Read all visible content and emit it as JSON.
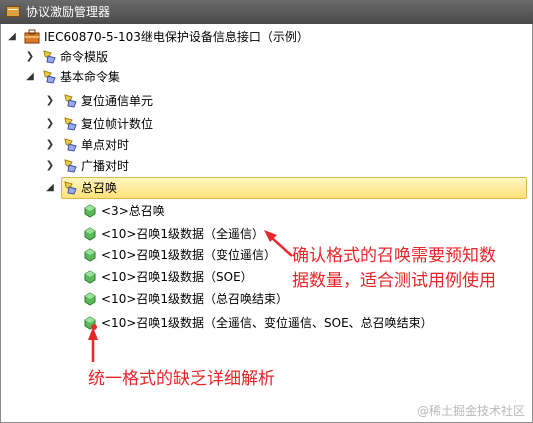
{
  "window": {
    "title": "协议激励管理器"
  },
  "tree": {
    "root": "IEC60870-5-103继电保护设备信息接口（示例）",
    "command_template": "命令模版",
    "basic_command_set": "基本命令集",
    "reset_comm_unit": "复位通信单元",
    "reset_frame_count": "复位帧计数位",
    "point_time_sync": "单点对时",
    "broadcast_time_sync": "广播对时",
    "general_interrogation": "总召唤",
    "items": [
      "<3>总召唤",
      "<10>召唤1级数据（全遥信）",
      "<10>召唤1级数据（变位遥信）",
      "<10>召唤1级数据（SOE）",
      "<10>召唤1级数据（总召唤结束）",
      "<10>召唤1级数据（全遥信、变位遥信、SOE、总召唤结束）"
    ]
  },
  "annotations": {
    "right_line1": "确认格式的召唤需要预知数",
    "right_line2": "据数量，适合测试用例使用",
    "bottom": "统一格式的缺乏详细解析"
  },
  "watermark": "@稀土掘金技术社区",
  "colors": {
    "annotation": "#e8262a",
    "selection": "#ffe27a",
    "titlebar": "#555555"
  }
}
